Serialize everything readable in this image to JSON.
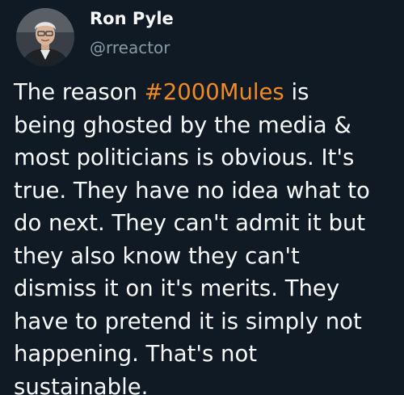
{
  "author": {
    "name": "Ron Pyle",
    "handle": "@rreactor",
    "avatar_icon": "profile-photo"
  },
  "tweet": {
    "line1_pre": "The reason ",
    "hashtag": "#2000Mules",
    "line1_post": " is",
    "line2": "being ghosted by the media &",
    "line3": "most politicians is obvious. It's",
    "line4": "true. They have no idea what to",
    "line5": "do next. They can't admit it but",
    "line6": "they also know they can't",
    "line7": "dismiss it on it's merits. They",
    "line8": "have to pretend it is simply not",
    "line9": "happening. That's not",
    "line10": "sustainable."
  },
  "colors": {
    "background": "#0f1a24",
    "hashtag": "#f28b1f",
    "handle": "#8899a6",
    "text": "#f7f9fa"
  }
}
